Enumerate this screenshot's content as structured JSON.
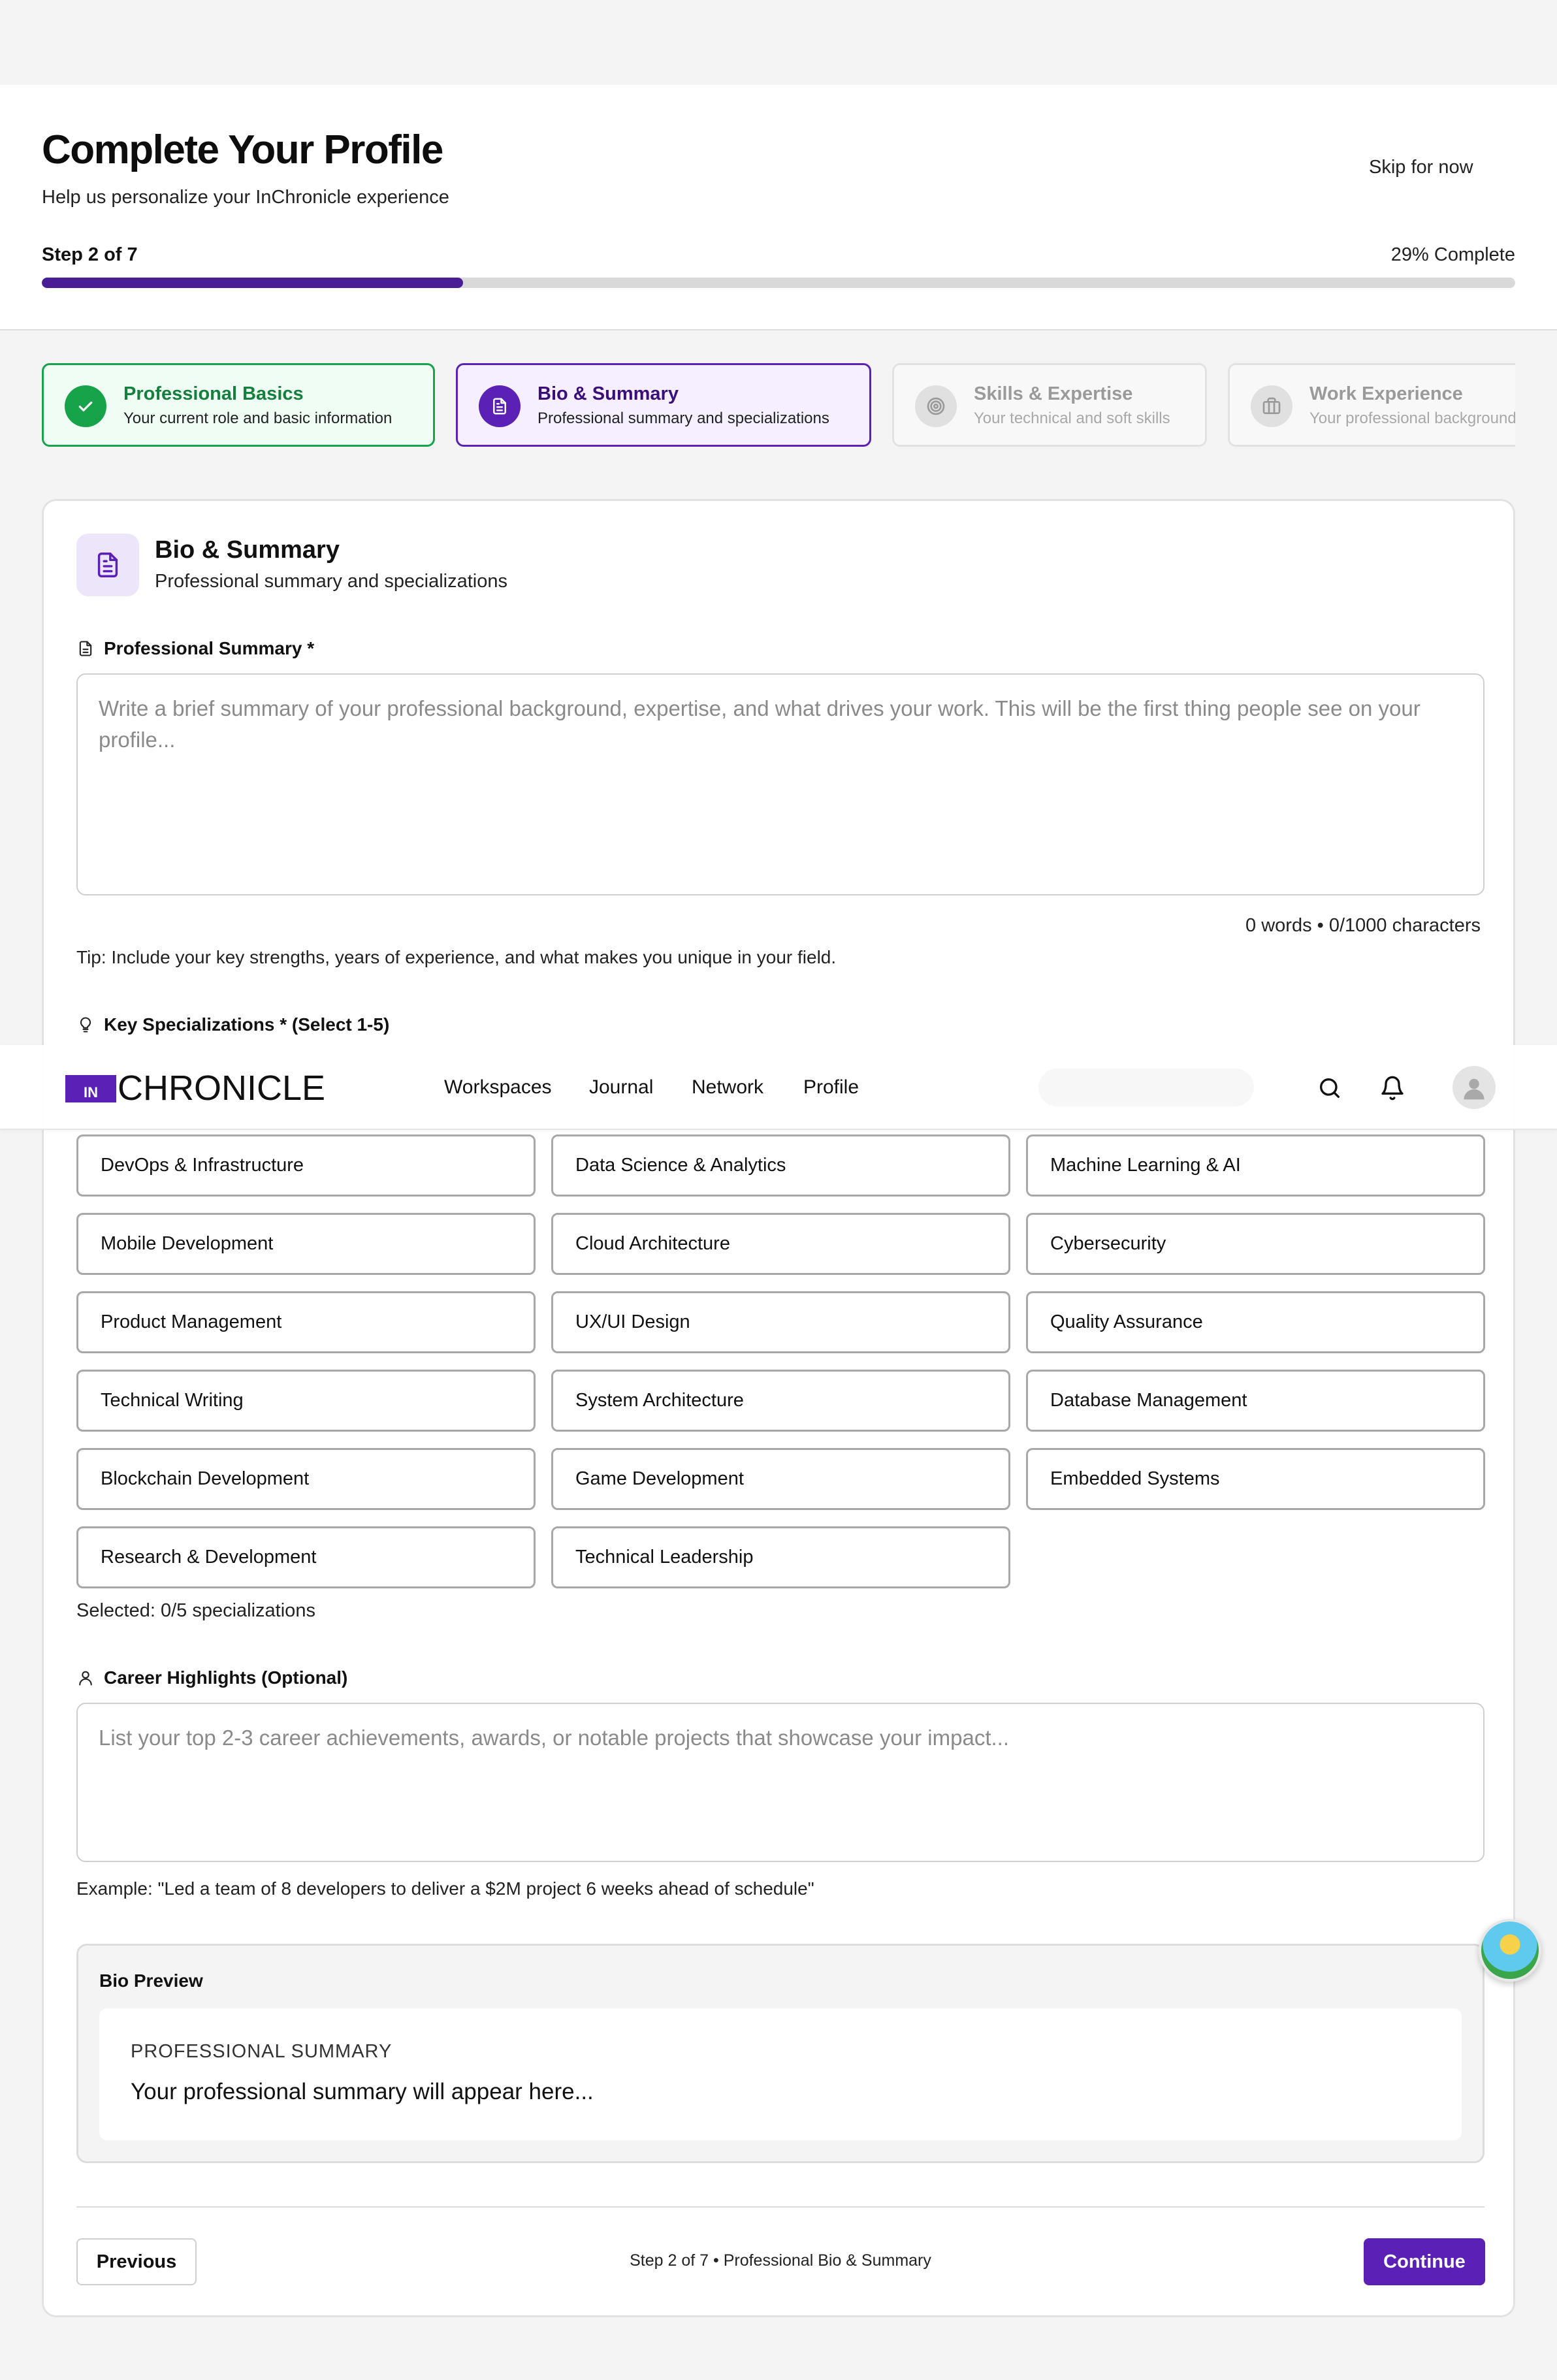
{
  "header": {
    "title": "Complete Your Profile",
    "subtitle": "Help us personalize your InChronicle experience",
    "skip_label": "Skip for now",
    "step_text": "Step 2 of 7",
    "percent_text": "29% Complete",
    "progress_fraction": 0.2857
  },
  "steps": [
    {
      "name": "Professional Basics",
      "desc": "Your current role and basic information",
      "state": "done",
      "icon": "check-icon"
    },
    {
      "name": "Bio & Summary",
      "desc": "Professional summary and specializations",
      "state": "active",
      "icon": "document-icon"
    },
    {
      "name": "Skills & Expertise",
      "desc": "Your technical and soft skills",
      "state": "upcoming",
      "icon": "target-icon"
    },
    {
      "name": "Work Experience",
      "desc": "Your professional background",
      "state": "upcoming",
      "icon": "briefcase-icon"
    }
  ],
  "section": {
    "title": "Bio & Summary",
    "subtitle": "Professional summary and specializations"
  },
  "summary": {
    "label": "Professional Summary *",
    "placeholder": "Write a brief summary of your professional background, expertise, and what drives your work. This will be the first thing people see on your profile...",
    "value": "",
    "count_text": "0 words • 0/1000 characters",
    "tip": "Tip: Include your key strengths, years of experience, and what makes you unique in your field."
  },
  "specializations": {
    "label": "Key Specializations * (Select 1-5)",
    "options": [
      "DevOps & Infrastructure",
      "Data Science & Analytics",
      "Machine Learning & AI",
      "Mobile Development",
      "Cloud Architecture",
      "Cybersecurity",
      "Product Management",
      "UX/UI Design",
      "Quality Assurance",
      "Technical Writing",
      "System Architecture",
      "Database Management",
      "Blockchain Development",
      "Game Development",
      "Embedded Systems",
      "Research & Development",
      "Technical Leadership"
    ],
    "selected_text": "Selected: 0/5 specializations"
  },
  "highlights": {
    "label": "Career Highlights (Optional)",
    "placeholder": "List your top 2-3 career achievements, awards, or notable projects that showcase your impact...",
    "value": "",
    "example": "Example: \"Led a team of 8 developers to deliver a $2M project 6 weeks ahead of schedule\""
  },
  "preview": {
    "title": "Bio Preview",
    "summary_label": "PROFESSIONAL SUMMARY",
    "summary_text": "Your professional summary will appear here..."
  },
  "footer": {
    "previous_label": "Previous",
    "step_caption": "Step 2 of 7 • Professional Bio & Summary",
    "continue_label": "Continue"
  },
  "nav": {
    "logo_in": "IN",
    "logo_text": "CHRONICLE",
    "links": [
      "Workspaces",
      "Journal",
      "Network",
      "Profile"
    ]
  },
  "colors": {
    "accent": "#5b21b6",
    "success": "#16a34a",
    "progress_track": "#d9d9d9"
  }
}
